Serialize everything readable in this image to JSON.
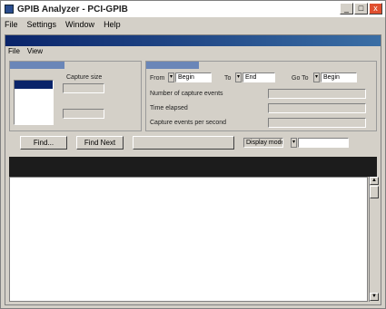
{
  "app": {
    "title": "GPIB Analyzer - PCI-GPIB"
  },
  "window_buttons": {
    "minimize": "_",
    "maximize": "□",
    "close": "x"
  },
  "menu": [
    "File",
    "Settings",
    "Window",
    "Help"
  ],
  "child": {
    "title": "",
    "menu": [
      "File",
      "View"
    ]
  },
  "capture_panel": {
    "header": "",
    "list_label": "",
    "list_items": [
      "",
      "",
      ""
    ],
    "capture_size_label": "Capture size",
    "capture_size_value": "",
    "handshake_label": "",
    "handshake_value": ""
  },
  "status_panel": {
    "header": "",
    "from_label": "From",
    "from_value": "Begin",
    "to_label": "To",
    "to_value": "End",
    "goto_label": "Go To",
    "goto_value": "Begin",
    "num_events_label": "Number of capture events",
    "num_events_value": "",
    "time_elapsed_label": "Time elapsed",
    "time_elapsed_value": "",
    "events_per_sec_label": "Capture events per second",
    "events_per_sec_value": ""
  },
  "toolbar": {
    "find_label": "Find...",
    "find_next_label": "Find Next",
    "switch_label": "",
    "display_mode_label": "Display mode",
    "display_mode_value": ""
  },
  "grid_header": {
    "col1": "",
    "col2": "",
    "col3": ""
  },
  "grid_rows": [
    {
      "n": "",
      "c": "",
      "data": ""
    },
    {
      "n": "",
      "c": "",
      "data": ""
    },
    {
      "n": "",
      "c": "",
      "data": ""
    },
    {
      "n": "",
      "c": "",
      "data": ""
    },
    {
      "n": "",
      "c": "",
      "data": ""
    },
    {
      "n": "",
      "c": "",
      "data": ""
    },
    {
      "n": "",
      "c": "",
      "data": ""
    },
    {
      "n": "",
      "c": "",
      "data": ""
    },
    {
      "n": "",
      "c": "",
      "data": ""
    },
    {
      "n": "",
      "c": "",
      "data": ""
    },
    {
      "n": "",
      "c": "",
      "data": ""
    },
    {
      "n": "",
      "c": "",
      "data": ""
    }
  ],
  "scroll": {
    "up": "▲",
    "down": "▼"
  },
  "colors": {
    "title_gradient_start": "#0a246a",
    "title_gradient_end": "#3a6ea5",
    "panel_head": "#6a86b8",
    "grid_header": "#1c1c1c"
  },
  "icons": [
    "app-icon",
    "close-icon",
    "minimize-icon",
    "maximize-icon",
    "spin-arrow-icon",
    "scroll-up-icon",
    "scroll-down-icon"
  ]
}
